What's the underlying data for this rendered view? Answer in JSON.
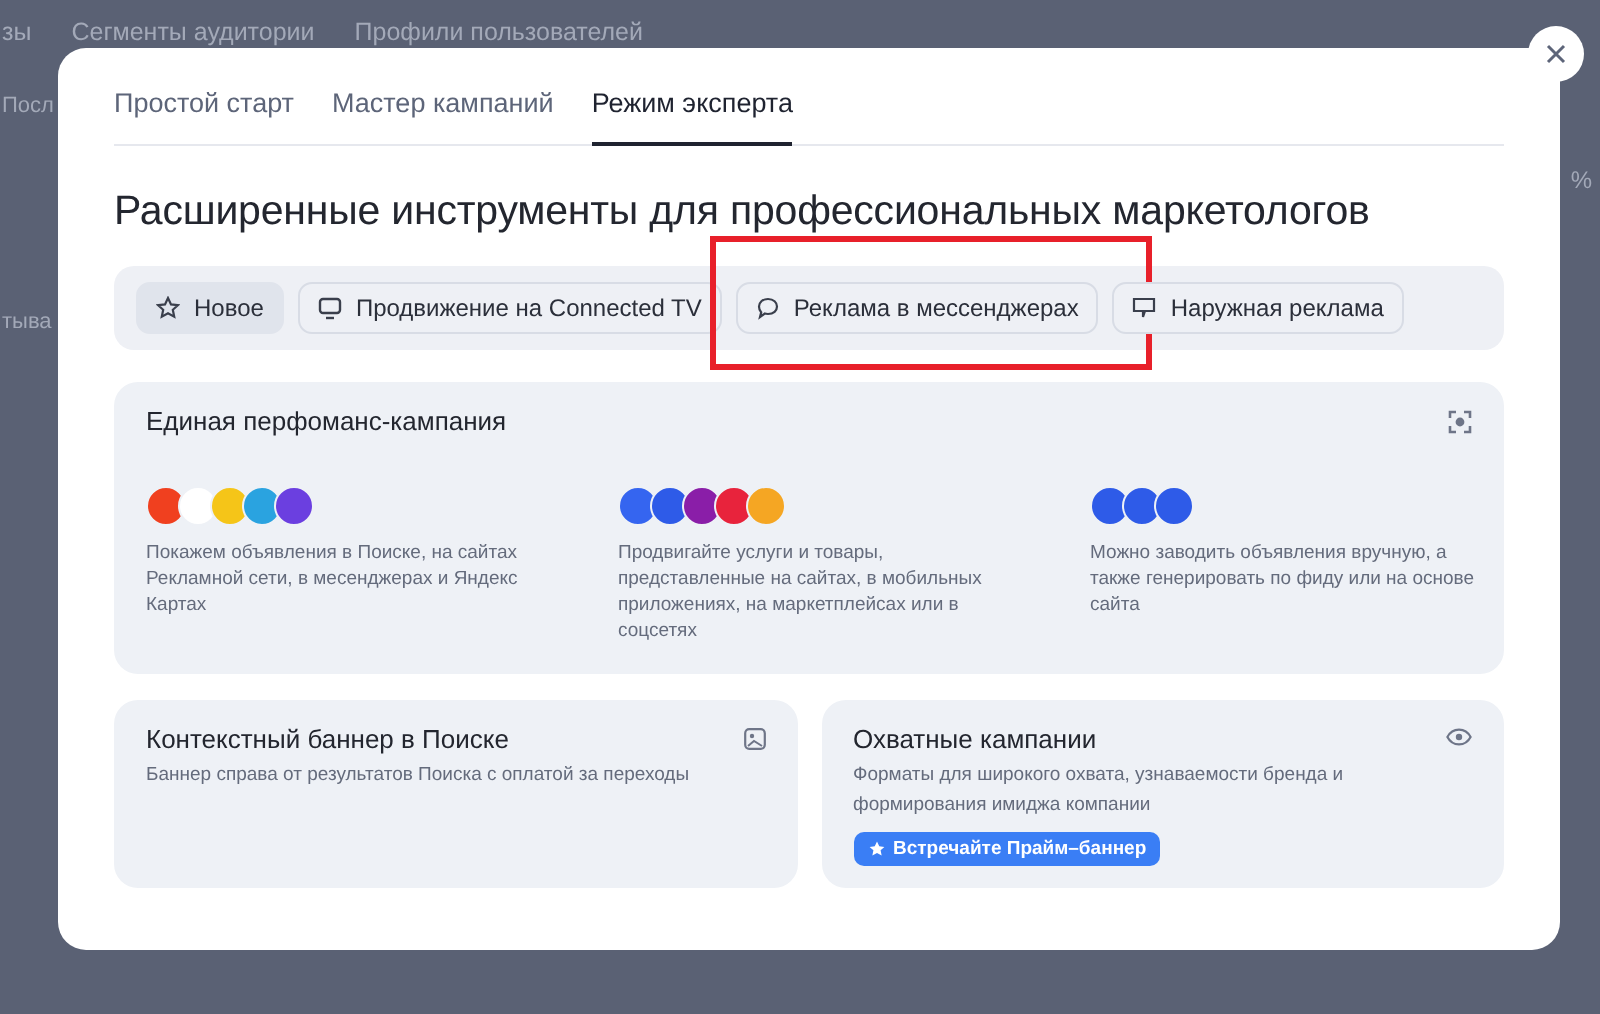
{
  "background": {
    "nav": [
      "зы",
      "Сегменты аудитории",
      "Профили пользователей"
    ],
    "side_texts": [
      "Посл",
      "тыва"
    ],
    "edge_text": "%"
  },
  "tabs": [
    {
      "label": "Простой старт",
      "selected": false
    },
    {
      "label": "Мастер кампаний",
      "selected": false
    },
    {
      "label": "Режим эксперта",
      "selected": true
    }
  ],
  "title": "Расширенные инструменты для профессиональных маркетологов",
  "chips": [
    {
      "label": "Новое",
      "selected": true,
      "highlighted": false
    },
    {
      "label": "Продвижение на Connected TV",
      "selected": false,
      "highlighted": false
    },
    {
      "label": "Реклама в мессенджерах",
      "selected": false,
      "highlighted": true
    },
    {
      "label": "Наружная реклама",
      "selected": false,
      "highlighted": false
    }
  ],
  "main_card": {
    "title": "Единая перфоманс-кампания",
    "features": [
      {
        "text": "Покажем объявления в Поиске, на сайтах Рекламной сети, в месенджерах и Яндекс Картах"
      },
      {
        "text": "Продвигайте услуги и товары, представленные на сайтах, в мобильных приложениях, на маркетплейсах или в соцсетях"
      },
      {
        "text": "Можно заводить объявления вручную, а также генерировать по фиду или на основе сайта"
      }
    ]
  },
  "cards": [
    {
      "title": "Контекстный баннер в Поиске",
      "text": "Баннер справа от результатов Поиска с оплатой за переходы"
    },
    {
      "title": "Охватные кампании",
      "text": "Форматы для широкого охвата, узнаваемости бренда и формирования имиджа компании",
      "button": "Встречайте Прайм–баннер"
    }
  ]
}
